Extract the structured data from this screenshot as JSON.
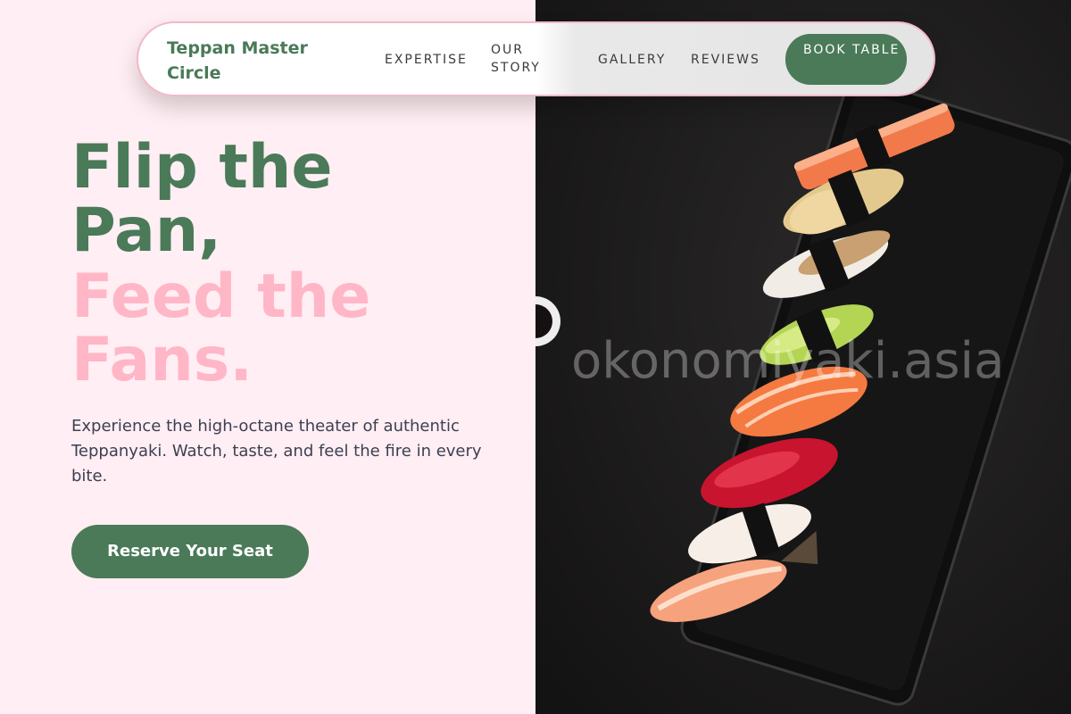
{
  "nav": {
    "brand": "Teppan Master Circle",
    "links": [
      "EXPERTISE",
      "OUR STORY",
      "GALLERY",
      "REVIEWS"
    ],
    "cta": "BOOK TABLE"
  },
  "hero": {
    "title_line1": "Flip the",
    "title_line2": "Pan,",
    "title_line3": "Feed the",
    "title_line4": "Fans.",
    "description": "Experience the high-octane theater of authentic Teppanyaki. Watch, taste, and feel the fire in every bite.",
    "cta": "Reserve Your Seat"
  },
  "image": {
    "watermark": "okonomiyaki.asia"
  },
  "colors": {
    "accent_green": "#4a7a58",
    "accent_pink": "#ffb6c6",
    "background_pink": "#ffeef3"
  }
}
